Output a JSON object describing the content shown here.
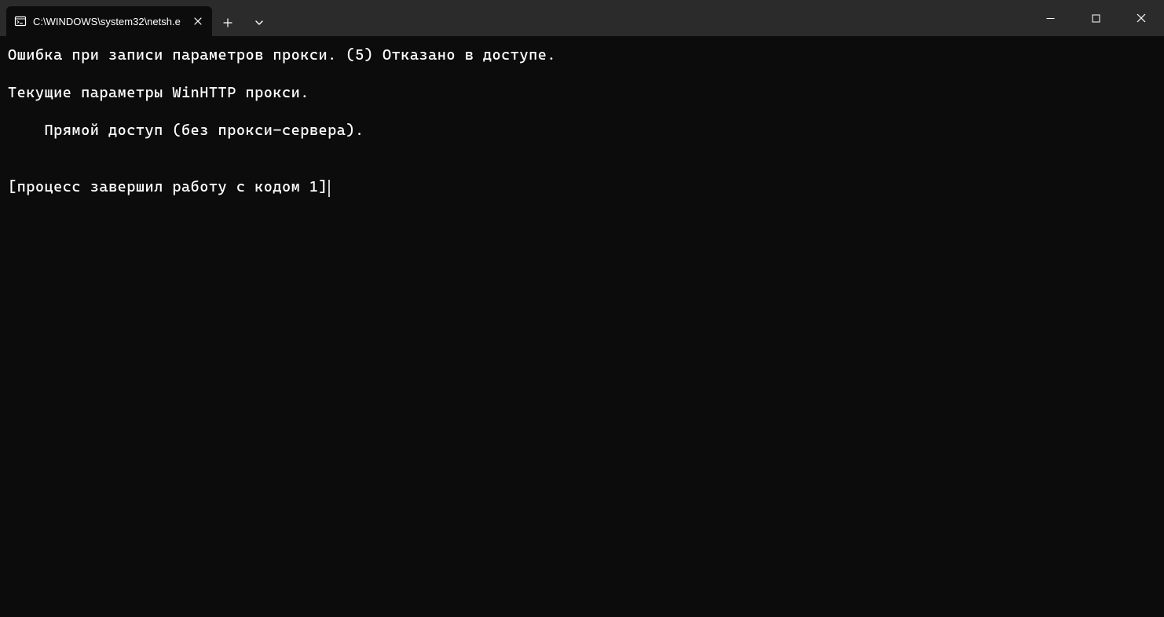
{
  "tab": {
    "title": "C:\\WINDOWS\\system32\\netsh.e",
    "icon": "terminal-icon"
  },
  "terminal": {
    "lines": [
      "Ошибка при записи параметров прокси. (5) Отказано в доступе.",
      "",
      "Текущие параметры WinHTTP прокси.",
      "",
      "    Прямой доступ (без прокси-сервера).",
      "",
      "",
      "[процесс завершил работу с кодом 1]"
    ]
  }
}
